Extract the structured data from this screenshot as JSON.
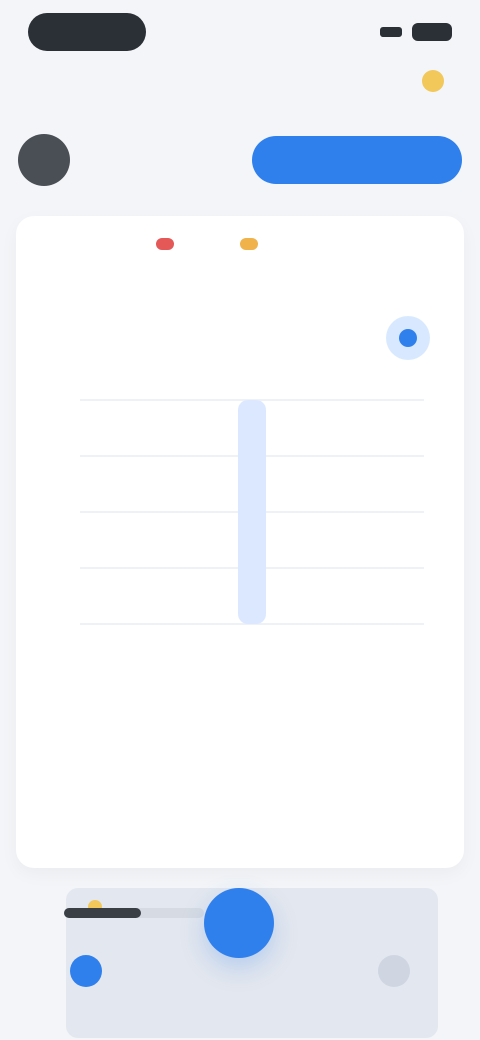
{
  "status": {
    "sig_icon": "signal-icon",
    "battery_icon": "battery-icon"
  },
  "top": {
    "title": "",
    "right_text": ""
  },
  "header": {
    "username": "",
    "primary_button": ""
  },
  "card": {
    "legend": [
      {
        "label": "",
        "color": "#e45858"
      },
      {
        "label": "",
        "color": "#f0b24a"
      }
    ],
    "legend_more": "",
    "subtitle": "",
    "value": "",
    "unit": "",
    "info_icon": "info-icon"
  },
  "chart_data": {
    "type": "bar",
    "categories": [
      ""
    ],
    "values": [
      1
    ],
    "ylim": [
      0,
      1
    ],
    "grid": true
  },
  "note": {
    "title": ""
  },
  "progress": {
    "value": 0.55
  },
  "nav": {
    "items": [
      {
        "label": "",
        "icon": "home-icon",
        "active": true
      },
      {
        "label": "",
        "icon": "profile-icon",
        "active": false
      }
    ]
  },
  "colors": {
    "primary": "#2f80ed",
    "card_bg": "#ffffff"
  }
}
